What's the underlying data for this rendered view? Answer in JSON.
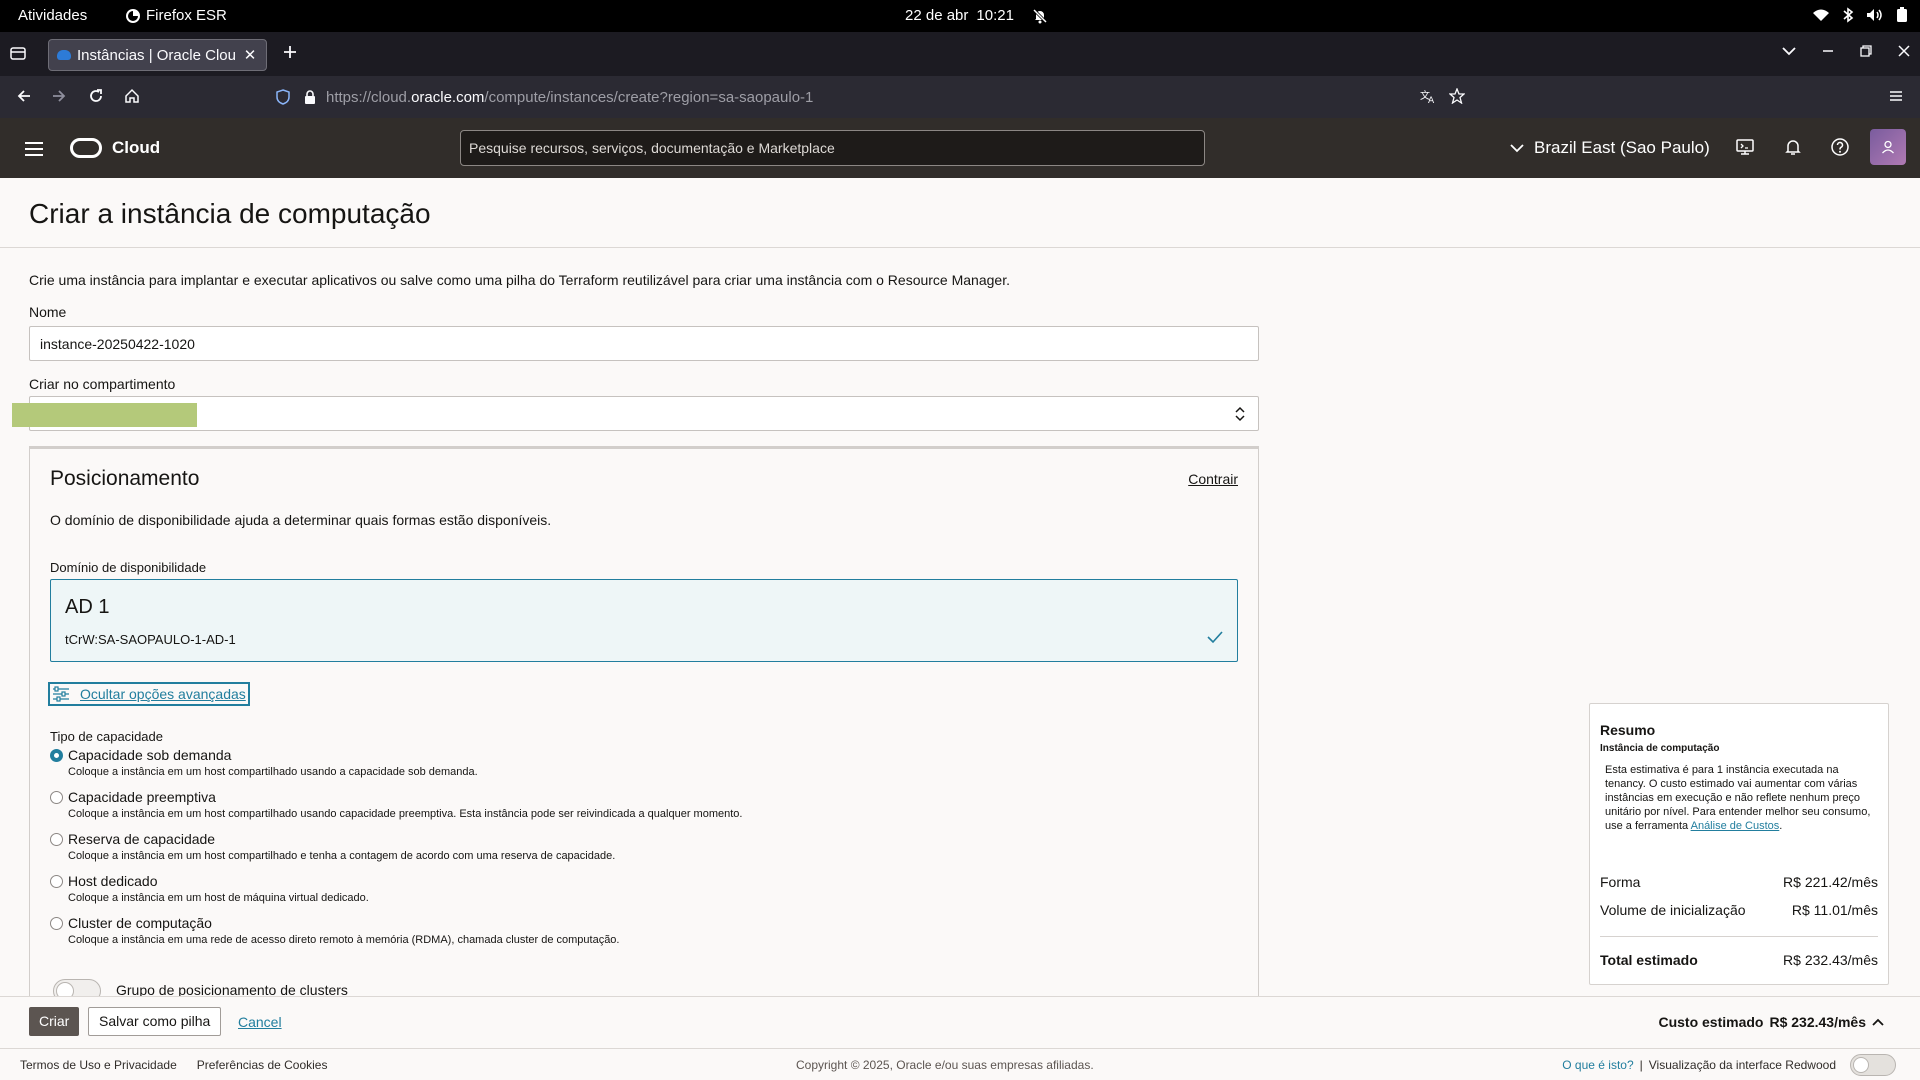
{
  "system_bar": {
    "activities": "Atividades",
    "app_name": "Firefox ESR",
    "date": "22 de abr",
    "time": "10:21"
  },
  "browser": {
    "tab_title": "Instâncias | Oracle Cloud I",
    "url_prefix": "https://cloud.",
    "url_domain": "oracle.com",
    "url_path": "/compute/instances/create?region=sa-saopaulo-1"
  },
  "oci_header": {
    "logo_text": "Cloud",
    "search_placeholder": "Pesquise recursos, serviços, documentação e Marketplace",
    "region": "Brazil East (Sao Paulo)"
  },
  "page": {
    "title": "Criar a instância de computação",
    "intro": "Crie uma instância para implantar e executar aplicativos ou salve como uma pilha do Terraform reutilizável para criar uma instância com o Resource Manager."
  },
  "form": {
    "name_label": "Nome",
    "name_value": "instance-20250422-1020",
    "compartment_label": "Criar no compartimento",
    "compartment_value": ""
  },
  "placement": {
    "title": "Posicionamento",
    "collapse": "Contrair",
    "description": "O domínio de disponibilidade ajuda a determinar quais formas estão disponíveis.",
    "ad_label": "Domínio de disponibilidade",
    "ad_name": "AD 1",
    "ad_id": "tCrW:SA-SAOPAULO-1-AD-1",
    "advanced_link": "Ocultar opções avançadas",
    "capacity_label": "Tipo de capacidade",
    "capacity_options": [
      {
        "title": "Capacidade sob demanda",
        "desc": "Coloque a instância em um host compartilhado usando a capacidade sob demanda.",
        "checked": true
      },
      {
        "title": "Capacidade preemptiva",
        "desc": "Coloque a instância em um host compartilhado usando capacidade preemptiva. Esta instância pode ser reivindicada a qualquer momento.",
        "checked": false
      },
      {
        "title": "Reserva de capacidade",
        "desc": "Coloque a instância em um host compartilhado e tenha a contagem de acordo com uma reserva de capacidade.",
        "checked": false
      },
      {
        "title": "Host dedicado",
        "desc": "Coloque a instância em um host de máquina virtual dedicado.",
        "checked": false
      },
      {
        "title": "Cluster de computação",
        "desc": "Coloque a instância em uma rede de acesso direto remoto à memória (RDMA), chamada cluster de computação.",
        "checked": false
      }
    ],
    "cluster_group_label": "Grupo de posicionamento de clusters",
    "cluster_group_enabled": false
  },
  "summary": {
    "title": "Resumo",
    "subtitle": "Instância de computação",
    "text": "Esta estimativa é para 1 instância executada na tenancy. O custo estimado vai aumentar com várias instâncias em execução e não reflete nenhum preço unitário por nível. Para entender melhor seu consumo, use a ferramenta ",
    "link": "Análise de Custos",
    "text_end": ".",
    "shape_label": "Forma",
    "shape_value": "R$ 221.42/mês",
    "boot_label": "Volume de inicialização",
    "boot_value": "R$ 11.01/mês",
    "total_label": "Total estimado",
    "total_value": "R$ 232.43/mês"
  },
  "actions": {
    "create": "Criar",
    "save_stack": "Salvar como pilha",
    "cancel": "Cancel",
    "estimated_label": "Custo estimado",
    "estimated_value": "R$ 232.43/mês"
  },
  "footer": {
    "terms": "Termos de Uso e Privacidade",
    "cookies": "Preferências de Cookies",
    "copyright": "Copyright © 2025, Oracle e/ou suas empresas afiliadas.",
    "what_is": "O que é isto?",
    "separator": "|",
    "redwood": "Visualização da interface Redwood"
  }
}
